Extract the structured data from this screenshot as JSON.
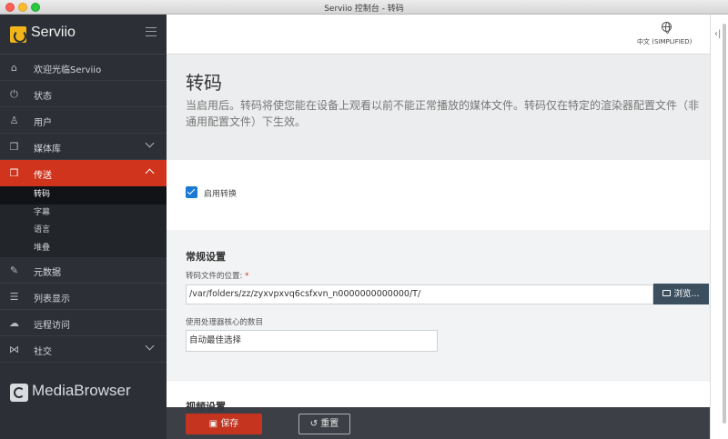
{
  "window": {
    "title": "Serviio 控制台 - 转码"
  },
  "sidebar": {
    "brand": "Serviio",
    "items": [
      {
        "label": "欢迎光临Serviio",
        "icon": "home-icon",
        "glyph": "⌂"
      },
      {
        "label": "状态",
        "icon": "plug-icon",
        "glyph": "⏻"
      },
      {
        "label": "用户",
        "icon": "user-icon",
        "glyph": "♙"
      },
      {
        "label": "媒体库",
        "icon": "library-icon",
        "glyph": "❐"
      },
      {
        "label": "传送",
        "icon": "box-icon",
        "glyph": "❒"
      },
      {
        "label": "元数据",
        "icon": "edit-icon",
        "glyph": "✎"
      },
      {
        "label": "列表显示",
        "icon": "list-icon",
        "glyph": "☰"
      },
      {
        "label": "远程访问",
        "icon": "cloud-icon",
        "glyph": "☁"
      },
      {
        "label": "社交",
        "icon": "share-icon",
        "glyph": "⋈"
      }
    ],
    "sub_items": [
      "转码",
      "字幕",
      "语言",
      "堆叠"
    ],
    "footer_logo": "MediaBrowser"
  },
  "header": {
    "language": "中文 (SIMPLIFIED)"
  },
  "page": {
    "title": "转码",
    "description": "当启用后。转码将使您能在设备上观看以前不能正常播放的媒体文件。转码仅在特定的渲染器配置文件（非通用配置文件）下生效。"
  },
  "enable": {
    "label": "启用转换",
    "checked": true
  },
  "general": {
    "title": "常规设置",
    "location_label": "转码文件的位置:",
    "location_required": "*",
    "location_value": "/var/folders/zz/zyxvpxvq6csfxvn_n0000000000000/T/",
    "browse_label": "浏览...",
    "cores_label": "使用处理器核心的数目",
    "cores_value": "自动最佳选择"
  },
  "video": {
    "title": "视频设置"
  },
  "actions": {
    "save": "保存",
    "reset": "重置"
  },
  "colors": {
    "accent": "#d0341c",
    "sidebar": "#2c3036",
    "checkbox": "#1a7ad4"
  }
}
